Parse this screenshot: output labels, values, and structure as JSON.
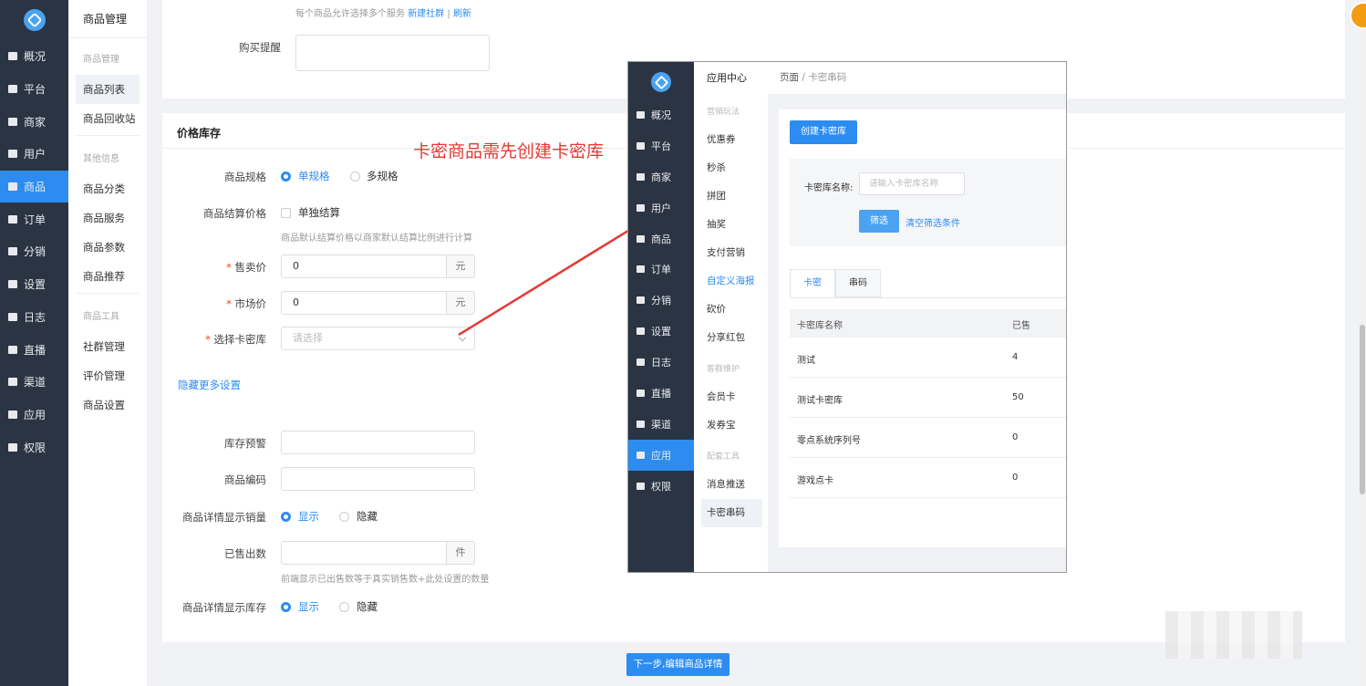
{
  "sidebar": {
    "items": [
      {
        "label": "概况",
        "icon": "overview-icon"
      },
      {
        "label": "平台",
        "icon": "monitor-icon"
      },
      {
        "label": "商家",
        "icon": "shop-icon"
      },
      {
        "label": "用户",
        "icon": "user-icon"
      },
      {
        "label": "商品",
        "icon": "goods-icon",
        "active": true
      },
      {
        "label": "订单",
        "icon": "order-icon"
      },
      {
        "label": "分销",
        "icon": "distribution-icon"
      },
      {
        "label": "设置",
        "icon": "gear-icon"
      },
      {
        "label": "日志",
        "icon": "log-icon"
      },
      {
        "label": "直播",
        "icon": "live-icon"
      },
      {
        "label": "渠道",
        "icon": "channel-icon"
      },
      {
        "label": "应用",
        "icon": "apps-icon"
      },
      {
        "label": "权限",
        "icon": "lock-icon"
      }
    ]
  },
  "subnav": {
    "title": "商品管理",
    "group1": "商品管理",
    "item_list": "商品列表",
    "item_recycle": "商品回收站",
    "group2": "其他信息",
    "item_category": "商品分类",
    "item_service": "商品服务",
    "item_param": "商品参数",
    "item_recommend": "商品推荐",
    "group3": "商品工具",
    "item_community": "社群管理",
    "item_review": "评价管理",
    "item_settings": "商品设置"
  },
  "form": {
    "top_hint": "每个商品允许选择多个服务",
    "top_hint_link1": "新建社群",
    "top_hint_sep": "|",
    "top_hint_link2": "刷新",
    "purchase_reminder_label": "购买提醒",
    "section_title": "价格库存",
    "spec_label": "商品规格",
    "spec_single": "单规格",
    "spec_multi": "多规格",
    "settle_label": "商品结算价格",
    "settle_option": "单独结算",
    "settle_hint": "商品默认结算价格以商家默认结算比例进行计算",
    "sale_price_label": "售卖价",
    "sale_price_value": "0",
    "sale_price_unit": "元",
    "market_price_label": "市场价",
    "market_price_value": "0",
    "market_price_unit": "元",
    "card_lib_label": "选择卡密库",
    "card_lib_placeholder": "请选择",
    "required_mark": "*",
    "toggle_more": "隐藏更多设置",
    "stock_alert_label": "库存预警",
    "code_label": "商品编码",
    "show_sales_label": "商品详情显示销量",
    "show": "显示",
    "hide": "隐藏",
    "sold_label": "已售出数",
    "sold_unit": "件",
    "sold_hint": "前端显示已出售数等于真实销售数+此处设置的数量",
    "show_stock_label": "商品详情显示库存",
    "next_button": "下一步,编辑商品详情"
  },
  "annotation": {
    "text": "卡密商品需先创建卡密库",
    "color": "#e53935"
  },
  "overlay": {
    "sidebar_items": [
      "概况",
      "平台",
      "商家",
      "用户",
      "商品",
      "订单",
      "分销",
      "设置",
      "日志",
      "直播",
      "渠道",
      "应用",
      "权限"
    ],
    "sub_title": "应用中心",
    "sub_group1": "营销玩法",
    "sub_coupon": "优惠券",
    "sub_seckill": "秒杀",
    "sub_group_buy": "拼团",
    "sub_lottery": "抽奖",
    "sub_pay_marketing": "支付营销",
    "sub_poster": "自定义海报",
    "sub_bargain": "砍价",
    "sub_red_packet": "分享红包",
    "sub_group2": "客群维护",
    "sub_member_card": "会员卡",
    "sub_coupon_treasure": "发券宝",
    "sub_group3": "配套工具",
    "sub_push": "消息推送",
    "sub_card_code": "卡密串码",
    "breadcrumb_root": "页面",
    "breadcrumb_sep": "/",
    "breadcrumb_current": "卡密串码",
    "create_button": "创建卡密库",
    "filter_label": "卡密库名称:",
    "filter_placeholder": "请输入卡密库名称",
    "filter_button": "筛选",
    "clear_button": "清空筛选条件",
    "tab_card": "卡密",
    "tab_code": "串码",
    "col_name": "卡密库名称",
    "col_sold": "已售",
    "rows": [
      {
        "name": "测试",
        "sold": "4"
      },
      {
        "name": "测试卡密库",
        "sold": "50"
      },
      {
        "name": "零点系统序列号",
        "sold": "0"
      },
      {
        "name": "游戏点卡",
        "sold": "0"
      }
    ]
  },
  "colors": {
    "primary": "#2d8cf0",
    "sidebar_bg": "#2b3443",
    "required": "#ed4014"
  }
}
